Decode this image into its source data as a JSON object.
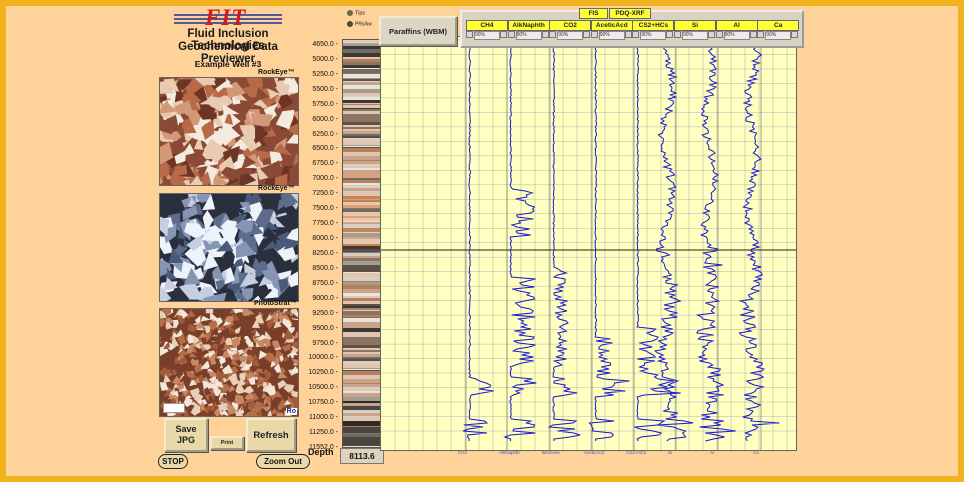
{
  "app": {
    "logo_text": "FIT",
    "title_line1": "Fluid Inclusion Technologies",
    "title_line2": "Geochemical Data Previewer",
    "well_name": "Example Well #3"
  },
  "images": [
    {
      "caption": "RockEye™",
      "palette": [
        "#b86a48",
        "#d39878",
        "#e8cbb0",
        "#8b4a35",
        "#f4ebe0",
        "#6e3426"
      ]
    },
    {
      "caption": "RockEye™",
      "palette": [
        "#4a5a78",
        "#8695b3",
        "#c6cfe2",
        "#2a2f3e",
        "#eef2fa",
        "#5d6c8c"
      ]
    },
    {
      "caption": "PhotoStrat™",
      "palette": [
        "#a25c3a",
        "#c98864",
        "#e8d0b8",
        "#7a3f28",
        "#f1e6d8",
        "#b36e4b"
      ],
      "corner_label": "Ro"
    }
  ],
  "buttons": {
    "save_jpg_line1": "Save",
    "save_jpg_line2": "JPG",
    "print": "Print",
    "refresh": "Refresh",
    "stop": "STOP",
    "zoom_out": "Zoom Out"
  },
  "depth": {
    "label": "Depth",
    "current": "8113.6",
    "ticks": [
      "4650.0",
      "5000.0",
      "5250.0",
      "5500.0",
      "5750.0",
      "6000.0",
      "6250.0",
      "6500.0",
      "6750.0",
      "7000.0",
      "7250.0",
      "7500.0",
      "7750.0",
      "8000.0",
      "8250.0",
      "8500.0",
      "8750.0",
      "9000.0",
      "9250.0",
      "9500.0",
      "9750.0",
      "10000.0",
      "10250.0",
      "10500.0",
      "10750.0",
      "11000.0",
      "11250.0",
      "11552.0"
    ]
  },
  "legend": {
    "tips": "Tips",
    "other": "PRs/kw"
  },
  "panel": {
    "paraffins_label": "Paraffins (WBM)",
    "fis_tab": "FIS",
    "pdq_tab": "PDQ-XRF",
    "control_text": "90%"
  },
  "tracks": {
    "names": [
      "CH4",
      "AlkNaphth",
      "CO2",
      "AceticAcd",
      "CS2+HCs",
      "Si",
      "Al",
      "Ca"
    ],
    "footer_labels": [
      "CH4",
      "AlkNaphth",
      "Benzene",
      "AceticAcd",
      "CS2+HCs",
      "Si",
      "Al",
      "Ca"
    ]
  },
  "colors": {
    "frame": "#f0b21c",
    "background": "#ffd29a",
    "plot_bg": "#ffffbf",
    "curve": "#1818d0",
    "header_yellow": "#ffff33"
  }
}
